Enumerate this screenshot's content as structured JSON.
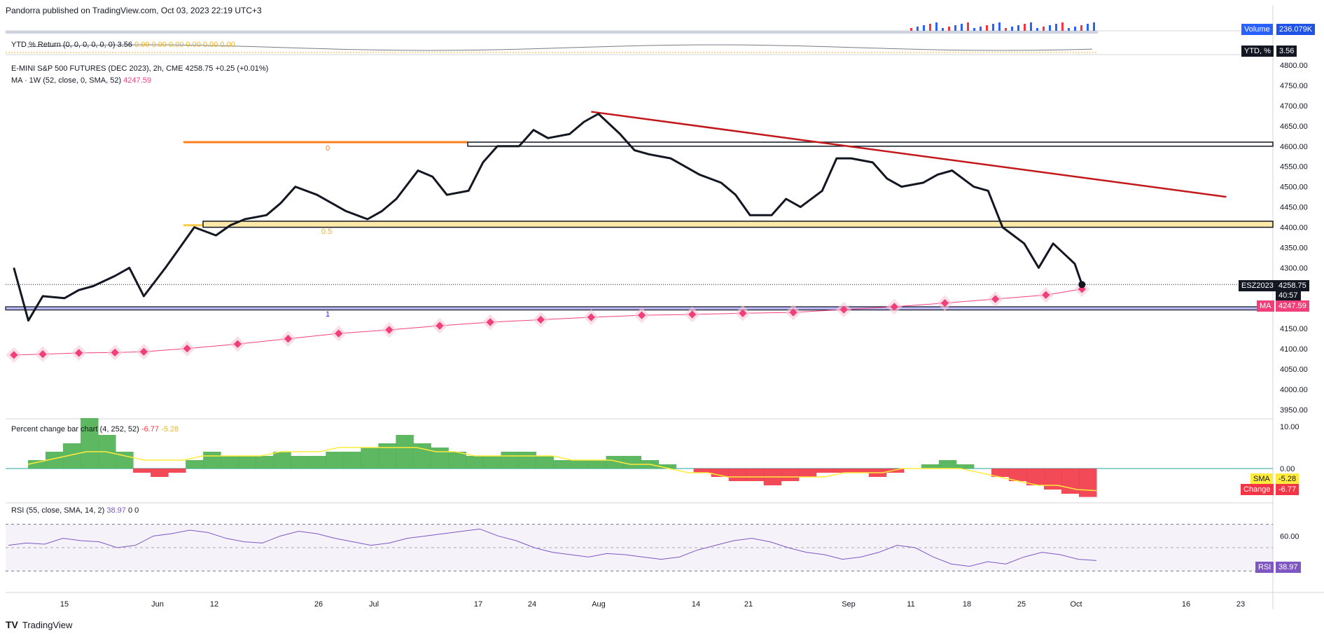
{
  "header": {
    "published": "Pandorra published on TradingView.com, Oct 03, 2023 22:19 UTC+3"
  },
  "footer": {
    "brand": "TradingView"
  },
  "volume_pane": {
    "label": "Volume",
    "value": "236.079K"
  },
  "ytd_pane": {
    "legend_name": "YTD % Return (0, 0, 0, 0, 0, 0)",
    "legend_value": "3.56",
    "legend_zeros": "0.00  0.00  0.00  0.00  0.00  0.00",
    "badge_label": "YTD, %",
    "badge_value": "3.56"
  },
  "main_pane": {
    "legend_symbol": "E-MINI S&P 500 FUTURES (DEC 2023), 2h, CME",
    "legend_price": "4258.75",
    "legend_change": "+0.25 (+0.01%)",
    "ma_legend": "MA · 1W (52, close, 0, SMA, 52)",
    "ma_value": "4247.59",
    "symbol_badge": "ESZ2023",
    "price_badge": "4258.75",
    "countdown": "40:57",
    "ma_badge_label": "MA",
    "ma_badge_value": "4247.59",
    "fib_labels": [
      "0",
      "0.5",
      "1"
    ],
    "colors": {
      "price": "#131722",
      "ma": "#f23f7a",
      "trend": "#c2181b",
      "fib0": "#ff7f1e",
      "fib05": "#ffc94a",
      "fib1": "#2b2bd6"
    }
  },
  "pct_pane": {
    "legend_name": "Percent change bar chart (4, 252, 52)",
    "legend_val1": "-6.77",
    "legend_val2": "-5.28",
    "sma_label": "SMA",
    "sma_value": "-5.28",
    "change_label": "Change",
    "change_value": "-6.77"
  },
  "rsi_pane": {
    "legend_name": "RSI (55, close, SMA, 14, 2)",
    "legend_value": "38.97",
    "legend_zeros": "0  0",
    "badge_label": "RSI",
    "badge_value": "38.97"
  },
  "chart_data": {
    "type": "line",
    "title": "E-MINI S&P 500 FUTURES (DEC 2023), 2h, CME",
    "x_tick_labels": [
      "15",
      "Jun",
      "12",
      "26",
      "Jul",
      "17",
      "24",
      "Aug",
      "14",
      "21",
      "Sep",
      "11",
      "18",
      "25",
      "Oct",
      "16",
      "23"
    ],
    "price_axis_ticks": [
      3950,
      4000,
      4050,
      4100,
      4150,
      4200,
      4250,
      4300,
      4350,
      4400,
      4450,
      4500,
      4550,
      4600,
      4650,
      4700,
      4750,
      4800
    ],
    "price_axis_labels": [
      "3950.00",
      "4000.00",
      "4050.00",
      "4100.00",
      "4150.00",
      "4200.00",
      "4250.00",
      "4300.00",
      "4350.00",
      "4400.00",
      "4450.00",
      "4500.00",
      "4550.00",
      "4600.00",
      "4650.00",
      "4700.00",
      "4750.00",
      "4800.00"
    ],
    "series": [
      {
        "name": "ESZ2023",
        "points": [
          [
            "May 08",
            4300
          ],
          [
            "May 10",
            4170
          ],
          [
            "May 12",
            4230
          ],
          [
            "May 15",
            4225
          ],
          [
            "May 17",
            4245
          ],
          [
            "May 19",
            4255
          ],
          [
            "May 22",
            4280
          ],
          [
            "May 24",
            4300
          ],
          [
            "May 26",
            4230
          ],
          [
            "May 29",
            4300
          ],
          [
            "May 31",
            4350
          ],
          [
            "Jun 02",
            4400
          ],
          [
            "Jun 05",
            4380
          ],
          [
            "Jun 07",
            4405
          ],
          [
            "Jun 09",
            4420
          ],
          [
            "Jun 12",
            4430
          ],
          [
            "Jun 14",
            4460
          ],
          [
            "Jun 16",
            4500
          ],
          [
            "Jun 19",
            4480
          ],
          [
            "Jun 21",
            4460
          ],
          [
            "Jun 23",
            4440
          ],
          [
            "Jun 26",
            4420
          ],
          [
            "Jun 28",
            4440
          ],
          [
            "Jun 30",
            4470
          ],
          [
            "Jul 03",
            4540
          ],
          [
            "Jul 05",
            4525
          ],
          [
            "Jul 07",
            4480
          ],
          [
            "Jul 10",
            4490
          ],
          [
            "Jul 12",
            4560
          ],
          [
            "Jul 14",
            4600
          ],
          [
            "Jul 17",
            4600
          ],
          [
            "Jul 19",
            4640
          ],
          [
            "Jul 21",
            4620
          ],
          [
            "Jul 24",
            4630
          ],
          [
            "Jul 26",
            4660
          ],
          [
            "Jul 28",
            4680
          ],
          [
            "Jul 31",
            4630
          ],
          [
            "Aug 02",
            4590
          ],
          [
            "Aug 04",
            4580
          ],
          [
            "Aug 07",
            4570
          ],
          [
            "Aug 09",
            4550
          ],
          [
            "Aug 11",
            4530
          ],
          [
            "Aug 14",
            4510
          ],
          [
            "Aug 16",
            4480
          ],
          [
            "Aug 18",
            4430
          ],
          [
            "Aug 21",
            4430
          ],
          [
            "Aug 23",
            4470
          ],
          [
            "Aug 25",
            4450
          ],
          [
            "Aug 28",
            4490
          ],
          [
            "Aug 30",
            4570
          ],
          [
            "Sep 01",
            4570
          ],
          [
            "Sep 04",
            4560
          ],
          [
            "Sep 06",
            4520
          ],
          [
            "Sep 08",
            4500
          ],
          [
            "Sep 11",
            4510
          ],
          [
            "Sep 13",
            4530
          ],
          [
            "Sep 15",
            4540
          ],
          [
            "Sep 18",
            4500
          ],
          [
            "Sep 20",
            4490
          ],
          [
            "Sep 22",
            4400
          ],
          [
            "Sep 25",
            4360
          ],
          [
            "Sep 27",
            4300
          ],
          [
            "Sep 29",
            4360
          ],
          [
            "Oct 02",
            4310
          ],
          [
            "Oct 03",
            4258.75
          ]
        ],
        "color": "#131722"
      },
      {
        "name": "MA",
        "points": [
          [
            "May 08",
            4085
          ],
          [
            "May 12",
            4087
          ],
          [
            "May 17",
            4090
          ],
          [
            "May 22",
            4091
          ],
          [
            "May 26",
            4093
          ],
          [
            "Jun 01",
            4101
          ],
          [
            "Jun 08",
            4112
          ],
          [
            "Jun 15",
            4125
          ],
          [
            "Jun 22",
            4138
          ],
          [
            "Jun 29",
            4147
          ],
          [
            "Jul 06",
            4157
          ],
          [
            "Jul 13",
            4166
          ],
          [
            "Jul 20",
            4172
          ],
          [
            "Jul 27",
            4178
          ],
          [
            "Aug 03",
            4183
          ],
          [
            "Aug 10",
            4185
          ],
          [
            "Aug 17",
            4188
          ],
          [
            "Aug 24",
            4190
          ],
          [
            "Aug 31",
            4197
          ],
          [
            "Sep 07",
            4204
          ],
          [
            "Sep 14",
            4213
          ],
          [
            "Sep 21",
            4223
          ],
          [
            "Sep 28",
            4233
          ],
          [
            "Oct 03",
            4247.59
          ]
        ],
        "color": "#f23f7a"
      }
    ],
    "horizontal_levels": [
      {
        "name": "fib-0",
        "label": "0",
        "value": 4610
      },
      {
        "name": "fib-0.5",
        "label": "0.5",
        "value": 4405
      },
      {
        "name": "fib-1",
        "label": "1",
        "value": 4200
      },
      {
        "name": "resistance-box",
        "value_low": 4600,
        "value_high": 4610
      },
      {
        "name": "support-box",
        "value_low": 4400,
        "value_high": 4415
      },
      {
        "name": "low-box",
        "value_low": 4196,
        "value_high": 4204
      }
    ],
    "trendline": {
      "from": [
        "Jul 27",
        4685
      ],
      "to": [
        "Oct 23",
        4475
      ]
    },
    "percent_change_series": {
      "name": "Percent change",
      "axis_ticks": [
        10.0,
        0.0
      ],
      "axis_labels": [
        "10.00",
        "0.00"
      ],
      "samples": [
        2,
        4,
        6,
        12,
        8,
        4,
        -1,
        -2,
        -1,
        2,
        4,
        3,
        3,
        3,
        4,
        3,
        3,
        4,
        4,
        5,
        6,
        8,
        6,
        5,
        4,
        3,
        3,
        4,
        4,
        3,
        2,
        2,
        2,
        3,
        3,
        2,
        1,
        0,
        -1,
        -2,
        -3,
        -3,
        -4,
        -3,
        -2,
        -1,
        -1,
        -1,
        -2,
        -1,
        0,
        1,
        2,
        1,
        0,
        -2,
        -3,
        -4,
        -5,
        -6,
        -6.77
      ],
      "sma_samples": [
        1,
        2,
        3,
        4,
        4,
        3,
        2,
        2,
        2,
        3,
        3,
        3,
        3,
        4,
        4,
        4,
        5,
        5,
        5,
        5,
        5,
        4,
        4,
        3,
        3,
        3,
        3,
        3,
        2,
        2,
        2,
        1,
        1,
        0,
        -1,
        -1,
        -2,
        -2,
        -2,
        -2,
        -2,
        -2,
        -1,
        -1,
        -1,
        0,
        0,
        0,
        0,
        -1,
        -2,
        -3,
        -4,
        -4,
        -5,
        -5.28
      ]
    },
    "rsi_series": {
      "name": "RSI",
      "axis_ticks": [
        60
      ],
      "axis_labels": [
        "60.00"
      ],
      "samples": [
        52,
        54,
        53,
        58,
        56,
        55,
        50,
        52,
        60,
        62,
        65,
        63,
        58,
        55,
        54,
        60,
        64,
        62,
        58,
        55,
        52,
        54,
        58,
        60,
        62,
        64,
        66,
        60,
        56,
        50,
        46,
        44,
        42,
        45,
        44,
        42,
        40,
        42,
        48,
        52,
        56,
        58,
        55,
        50,
        46,
        44,
        40,
        42,
        46,
        52,
        50,
        42,
        36,
        34,
        38,
        36,
        42,
        46,
        44,
        40,
        38.97
      ]
    }
  }
}
